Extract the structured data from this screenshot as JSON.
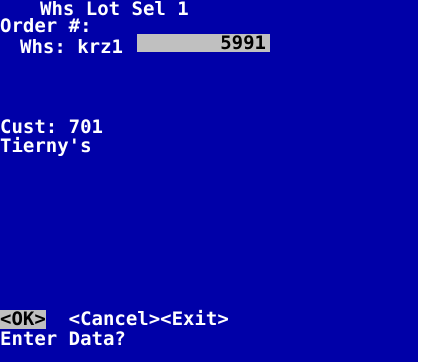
{
  "screen": {
    "title": "Whs Lot Sel 1",
    "order_label": "Order #:",
    "order_value": "5991",
    "whs_label": "Whs:",
    "whs_value": "krz1",
    "cust_label": "Cust:",
    "cust_value": "701",
    "cust_name": "Tierny's"
  },
  "softkeys": {
    "ok": "<OK>",
    "cancel": "<Cancel>",
    "exit": "<Exit>"
  },
  "status": {
    "prompt": "Enter Data?"
  },
  "colors": {
    "background": "#0000a8",
    "foreground": "#ffffff",
    "highlight": "#c0c0c0"
  }
}
